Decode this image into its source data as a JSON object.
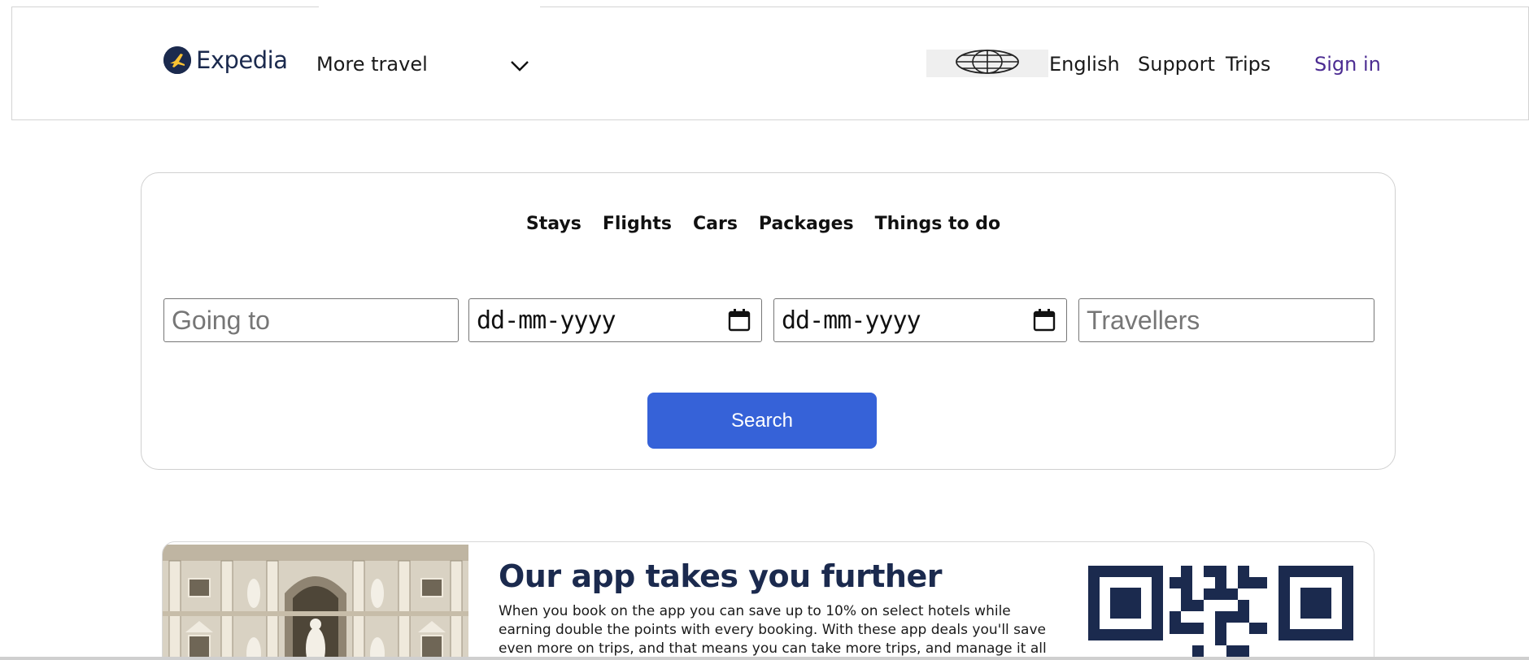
{
  "header": {
    "logo_text": "Expedia",
    "logo_icon": "plane-in-circle-icon",
    "more_travel_label": "More travel",
    "chevron_icon": "chevron-down-icon",
    "globe_icon": "globe-icon",
    "language_label": "English",
    "support_label": "Support",
    "trips_label": "Trips",
    "sign_in_label": "Sign in",
    "sign_in_color": "#4c2c92"
  },
  "search": {
    "tabs": [
      {
        "label": "Stays"
      },
      {
        "label": "Flights"
      },
      {
        "label": "Cars"
      },
      {
        "label": "Packages"
      },
      {
        "label": "Things to do"
      }
    ],
    "going_to_placeholder": "Going to",
    "check_in_value": "dd-mm-yyyy",
    "check_out_value": "dd-mm-yyyy",
    "travellers_placeholder": "Travellers",
    "calendar_icon": "calendar-icon",
    "search_button_label": "Search",
    "search_button_color": "#3662d8"
  },
  "promo": {
    "title": "Our app takes you further",
    "body": "When you book on the app you can save up to 10% on select hotels while earning double the points with every booking. With these app deals you'll save even more on trips, and that means you can take more trips, and manage it all on the go.",
    "image": "trevi-fountain-photo",
    "qr_icon": "qr-code-icon",
    "brand_navy": "#1b2a4e"
  }
}
